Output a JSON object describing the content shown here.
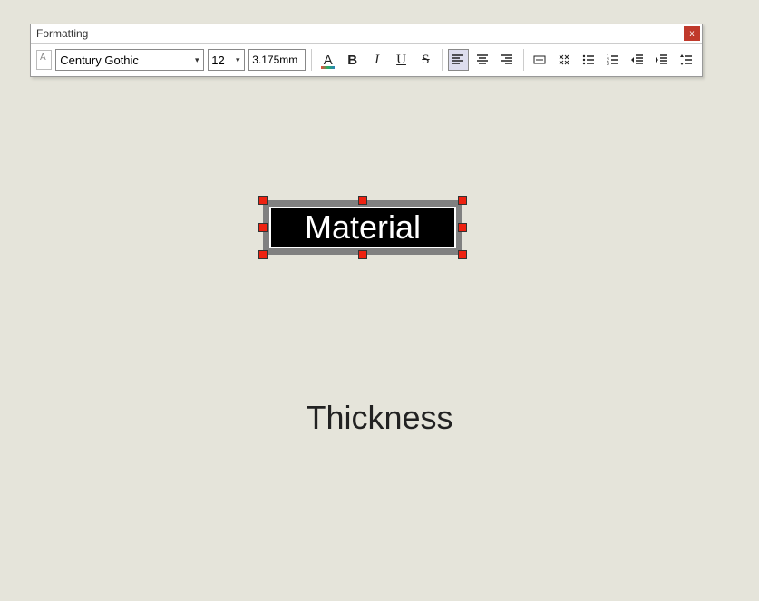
{
  "toolbar": {
    "title": "Formatting",
    "font_name": "Century Gothic",
    "font_size": "12",
    "measurement": "3.175mm",
    "close": "x",
    "buttons": {
      "bold": "B",
      "italic": "I",
      "underline": "U",
      "strike": "S",
      "font_color_letter": "A"
    }
  },
  "canvas": {
    "material_label": "Material",
    "thickness_label": "Thickness"
  }
}
